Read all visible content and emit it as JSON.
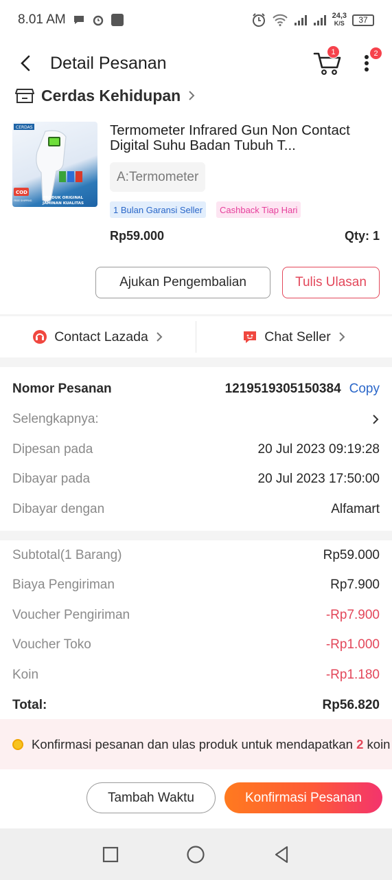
{
  "status_bar": {
    "time": "8.01 AM",
    "speed_top": "24,3",
    "speed_bottom": "K/S",
    "battery": "37"
  },
  "header": {
    "title": "Detail Pesanan",
    "cart_badge": "1",
    "more_badge": "2"
  },
  "shop": {
    "name": "Cerdas Kehidupan"
  },
  "product": {
    "name": "Termometer Infrared Gun Non Contact Digital Suhu Badan Tubuh T...",
    "variant": "A:Termometer",
    "tags": [
      "1 Bulan Garansi Seller",
      "Cashback Tiap Hari"
    ],
    "price": "Rp59.000",
    "qty": "Qty: 1",
    "image_text": {
      "brand": "CERDAS",
      "cod": "COD",
      "free_shipping": "FREE SHIPPING",
      "caption1": "PRODUK ORIGINAL",
      "caption2": "JAMINAN KUALITAS"
    }
  },
  "actions": {
    "return_label": "Ajukan Pengembalian",
    "review_label": "Tulis Ulasan"
  },
  "contact": {
    "lazada_label": "Contact Lazada",
    "seller_label": "Chat Seller"
  },
  "order": {
    "number_label": "Nomor Pesanan",
    "number_value": "1219519305150384",
    "copy_label": "Copy",
    "more_label": "Selengkapnya:",
    "ordered_label": "Dipesan pada",
    "ordered_value": "20 Jul 2023  09:19:28",
    "paid_label": "Dibayar pada",
    "paid_value": "20 Jul 2023  17:50:00",
    "method_label": "Dibayar dengan",
    "method_value": "Alfamart"
  },
  "summary": {
    "subtotal_label": "Subtotal(1 Barang)",
    "subtotal_value": "Rp59.000",
    "shipping_label": "Biaya Pengiriman",
    "shipping_value": "Rp7.900",
    "ship_voucher_label": "Voucher Pengiriman",
    "ship_voucher_value": "-Rp7.900",
    "shop_voucher_label": "Voucher Toko",
    "shop_voucher_value": "-Rp1.000",
    "coin_label": "Koin",
    "coin_value": "-Rp1.180",
    "total_label": "Total:",
    "total_value": "Rp56.820"
  },
  "banner": {
    "text_before": "Konfirmasi pesanan dan ulas produk untuk mendapatkan ",
    "coin_count": "2",
    "text_after": " koin"
  },
  "bottom": {
    "extend_label": "Tambah Waktu",
    "confirm_label": "Konfirmasi Pesanan"
  },
  "colors": {
    "accent_red": "#e3475a",
    "link_blue": "#2b67c9",
    "confirm_gradient_start": "#ff7a1f",
    "confirm_gradient_end": "#f3346d"
  }
}
